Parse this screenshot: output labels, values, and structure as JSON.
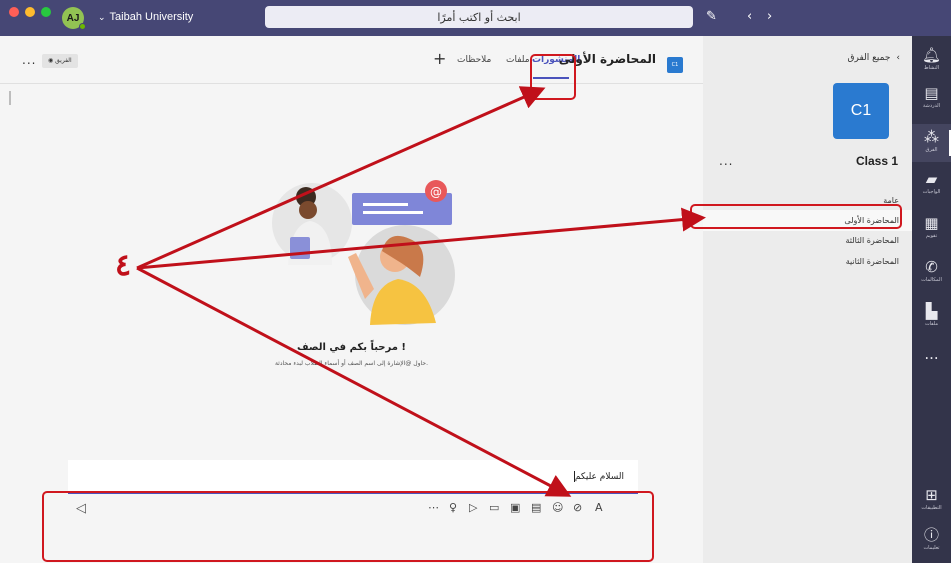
{
  "titlebar": {
    "avatar_initials": "AJ",
    "org_name": "Taibah University",
    "search_placeholder": "ابحث أو اكتب أمرًا"
  },
  "rail": {
    "items": [
      {
        "label": "النشاط",
        "icon": "bell-icon"
      },
      {
        "label": "الدردشة",
        "icon": "chat-icon"
      },
      {
        "label": "الفرق",
        "icon": "teams-icon"
      },
      {
        "label": "الواجبات",
        "icon": "assignments-icon"
      },
      {
        "label": "تقويم",
        "icon": "calendar-icon"
      },
      {
        "label": "المكالمات",
        "icon": "phone-icon"
      },
      {
        "label": "ملفات",
        "icon": "files-icon"
      },
      {
        "label": "التطبيقات",
        "icon": "apps-icon"
      },
      {
        "label": "تعليمات",
        "icon": "help-icon"
      }
    ],
    "more": "..."
  },
  "teams_pane": {
    "back_label": "جميع الفرق",
    "tile_text": "C1",
    "team_name": "Class 1",
    "more": "...",
    "channels": [
      "عامة",
      "المحاضرة الأولى",
      "المحاضرة الثالثة",
      "المحاضرة الثانية"
    ],
    "selected_channel_index": 1
  },
  "header": {
    "badge": "C1",
    "channel_title": "المحاضرة الأولى",
    "tabs": [
      "المنشورات",
      "ملفات",
      "ملاحظات"
    ],
    "active_tab_index": 0,
    "add": "+",
    "team_pill": "الفريق",
    "more": "..."
  },
  "welcome": {
    "title": "مرحباً بكم في الصف !",
    "subtitle": "حاول @الإشارة إلى اسم الصف أو أسماء الطلاب لبدء محادثة."
  },
  "compose": {
    "text": "السلام عليكم",
    "tools": [
      "format-icon",
      "attach-icon",
      "emoji-icon",
      "gif-icon",
      "sticker-icon",
      "meet-icon",
      "send-praise-icon",
      "praise-icon",
      "more-icon"
    ]
  },
  "annotation": {
    "number": "٤",
    "color": "#d0181f"
  },
  "colors": {
    "titlebar": "#464775",
    "rail": "#33344a",
    "accent": "#4b53bc",
    "tile": "#2a7ad0"
  }
}
